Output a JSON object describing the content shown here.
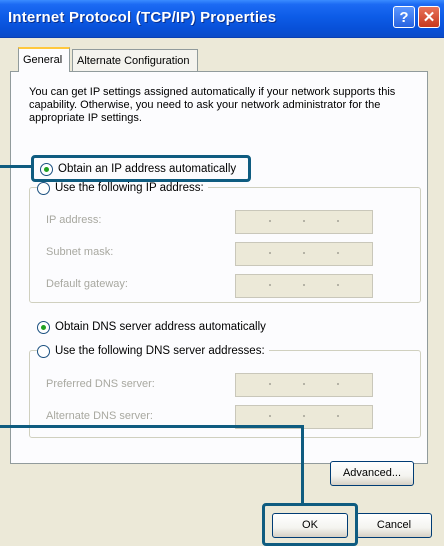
{
  "window": {
    "title": "Internet Protocol (TCP/IP) Properties",
    "help_glyph": "?",
    "close_glyph": "✕"
  },
  "tabs": {
    "general": "General",
    "alternate": "Alternate Configuration"
  },
  "description": "You can get IP settings assigned automatically if your network supports this capability. Otherwise, you need to ask your network administrator for the appropriate IP settings.",
  "ip_section": {
    "auto_label": "Obtain an IP address automatically",
    "auto_selected": true,
    "manual_label": "Use the following IP address:",
    "fields": {
      "ip_address": "IP address:",
      "subnet_mask": "Subnet mask:",
      "default_gateway": "Default gateway:"
    }
  },
  "dns_section": {
    "auto_label": "Obtain DNS server address automatically",
    "auto_selected": true,
    "manual_label": "Use the following DNS server addresses:",
    "fields": {
      "preferred": "Preferred DNS server:",
      "alternate": "Alternate DNS server:"
    }
  },
  "buttons": {
    "advanced": "Advanced...",
    "ok": "OK",
    "cancel": "Cancel"
  },
  "colors": {
    "titlebar": "#0850D8",
    "dialog_bg": "#ECE9D8",
    "callout": "#0F5C80",
    "radio_dot": "#21A121"
  }
}
